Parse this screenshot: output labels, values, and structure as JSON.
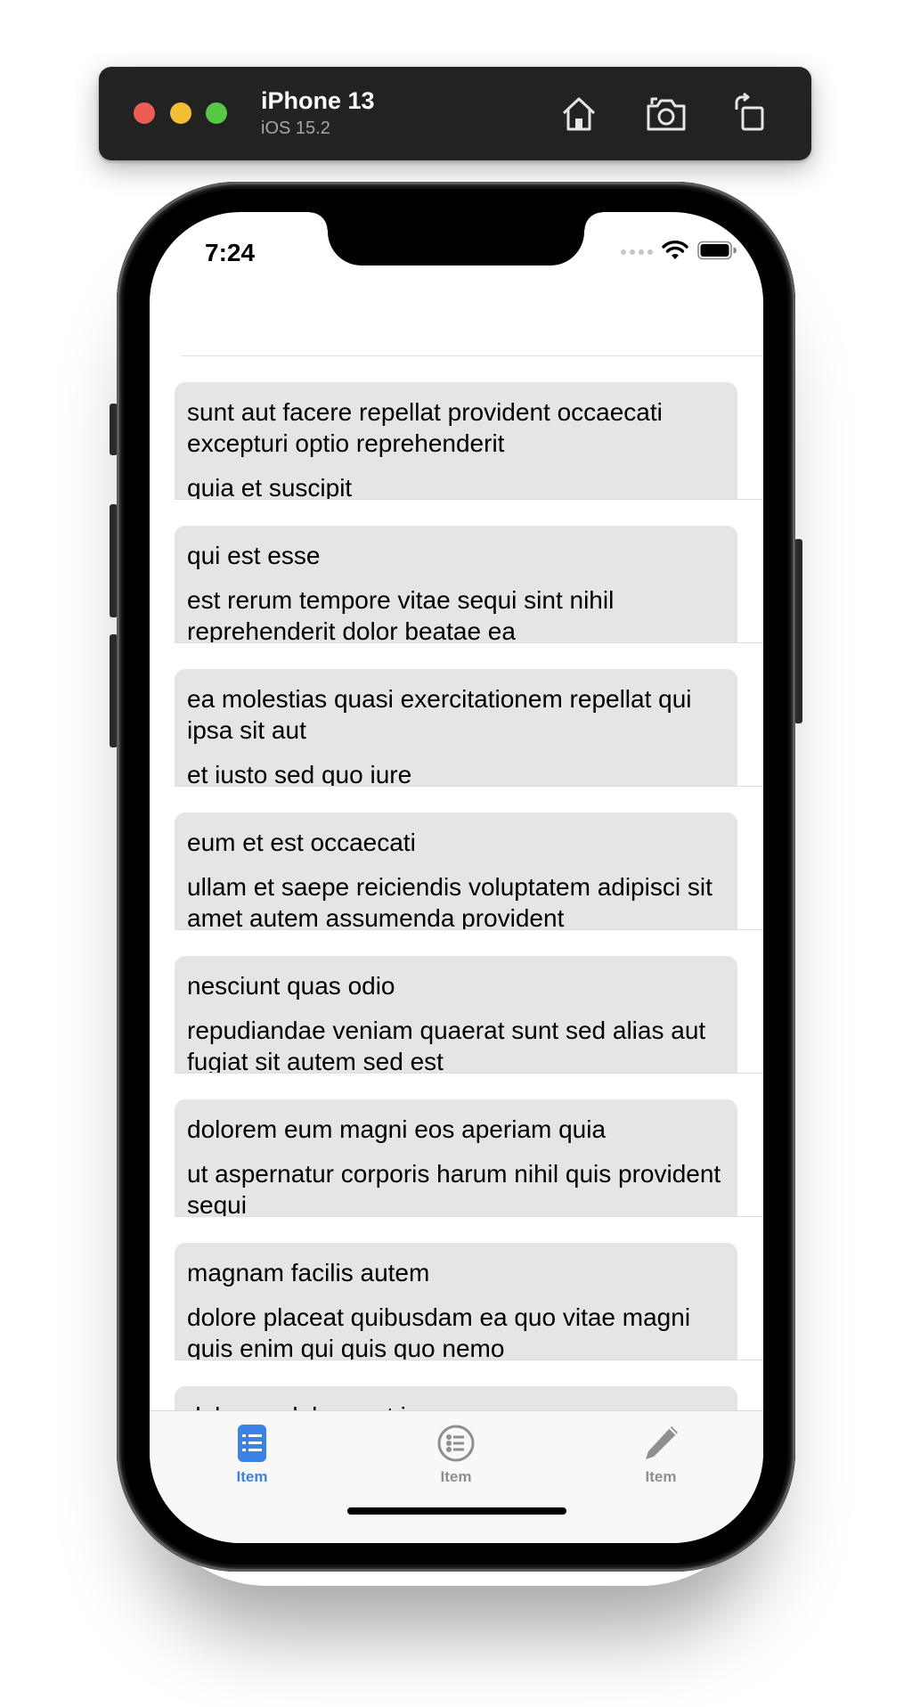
{
  "simulator": {
    "device_name": "iPhone 13",
    "os_version": "iOS 15.2",
    "toolbar_icons": [
      "home-icon",
      "screenshot-icon",
      "rotate-icon"
    ]
  },
  "status_bar": {
    "time": "7:24",
    "icons": [
      "cellular-dots-icon",
      "wifi-icon",
      "battery-icon"
    ]
  },
  "list": {
    "items": [
      {
        "title": "sunt aut facere repellat provident occaecati excepturi optio reprehenderit",
        "body": "quia et suscipit"
      },
      {
        "title": "qui est esse",
        "body": "est rerum tempore vitae sequi sint nihil reprehenderit dolor beatae ea"
      },
      {
        "title": "ea molestias quasi exercitationem repellat qui ipsa sit aut",
        "body": "et iusto sed quo iure"
      },
      {
        "title": "eum et est occaecati",
        "body": "ullam et saepe reiciendis voluptatem adipisci sit amet autem assumenda provident"
      },
      {
        "title": "nesciunt quas odio",
        "body": "repudiandae veniam quaerat sunt sed alias aut fugiat sit autem sed est"
      },
      {
        "title": "dolorem eum magni eos aperiam quia",
        "body": "ut aspernatur corporis harum nihil quis provident sequi"
      },
      {
        "title": "magnam facilis autem",
        "body": "dolore placeat quibusdam ea quo vitae magni quis enim qui quis quo nemo"
      },
      {
        "title": "dolorem dolore est ipsam",
        "body": ""
      }
    ]
  },
  "tab_bar": {
    "tabs": [
      {
        "label": "Item",
        "icon": "list-clipboard-icon",
        "selected": true
      },
      {
        "label": "Item",
        "icon": "list-circle-icon",
        "selected": false
      },
      {
        "label": "Item",
        "icon": "pencil-icon",
        "selected": false
      }
    ]
  },
  "colors": {
    "accent": "#3b82e4",
    "card_background": "#e5e5e5",
    "inactive_tab": "#8e8e93"
  }
}
